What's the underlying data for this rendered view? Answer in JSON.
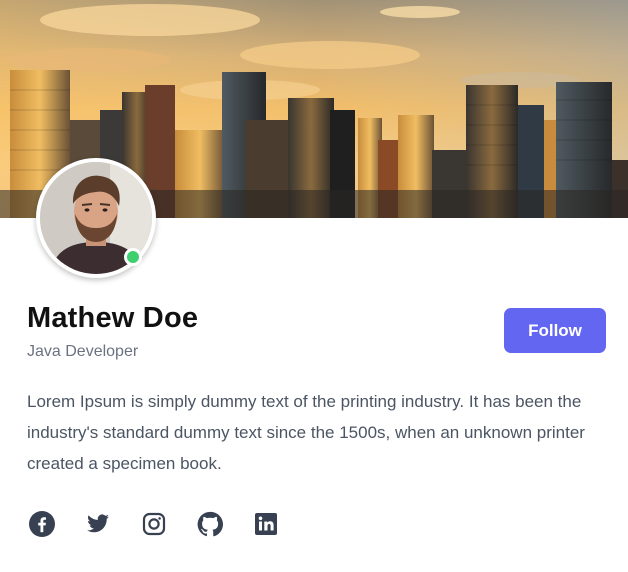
{
  "profile": {
    "name": "Mathew Doe",
    "role": "Java Developer",
    "bio": "Lorem Ipsum is simply dummy text of the printing industry. It has been the industry's standard dummy text since the 1500s, when an unknown printer created a specimen book.",
    "online": true
  },
  "actions": {
    "follow_label": "Follow"
  },
  "social_links": [
    {
      "icon": "facebook-icon"
    },
    {
      "icon": "twitter-icon"
    },
    {
      "icon": "instagram-icon"
    },
    {
      "icon": "github-icon"
    },
    {
      "icon": "linkedin-icon"
    }
  ],
  "colors": {
    "accent": "#6366f1",
    "status_online": "#3ecf6e",
    "name_text": "#111111",
    "muted_text": "#6b7280",
    "body_text": "#4b5563",
    "icon": "#374151"
  }
}
